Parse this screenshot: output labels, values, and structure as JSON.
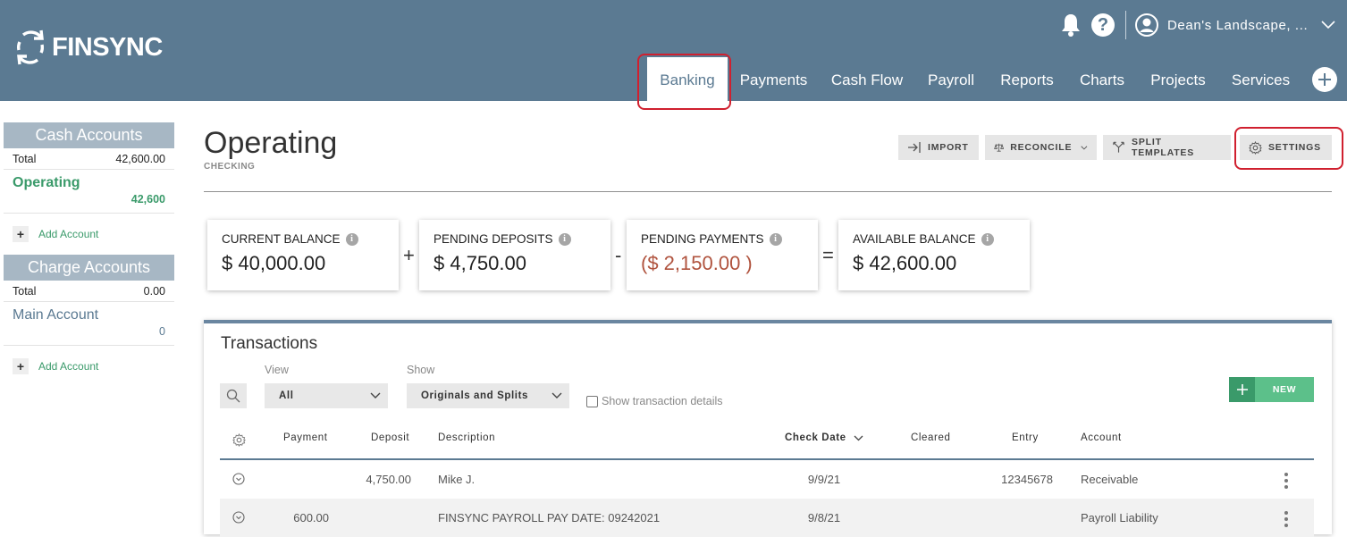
{
  "brand": {
    "name": "FINSYNC"
  },
  "header": {
    "company": "Dean's Landscape, ...",
    "help_glyph": "?",
    "nav": [
      {
        "label": "Banking",
        "active": true
      },
      {
        "label": "Payments",
        "active": false
      },
      {
        "label": "Cash Flow",
        "active": false
      },
      {
        "label": "Payroll",
        "active": false
      },
      {
        "label": "Reports",
        "active": false
      },
      {
        "label": "Charts",
        "active": false
      },
      {
        "label": "Projects",
        "active": false
      },
      {
        "label": "Services",
        "active": false
      }
    ],
    "icons": [
      "bell-icon",
      "help-icon",
      "user-icon",
      "chevron-down-icon",
      "plus-icon"
    ]
  },
  "sidebar": {
    "cash": {
      "title": "Cash Accounts",
      "total_label": "Total",
      "total_value": "42,600.00",
      "accounts": [
        {
          "name": "Operating",
          "value": "42,600",
          "active": true
        }
      ],
      "add_label": "Add Account"
    },
    "charge": {
      "title": "Charge Accounts",
      "total_label": "Total",
      "total_value": "0.00",
      "accounts": [
        {
          "name": "Main Account",
          "value": "0",
          "active": false
        }
      ],
      "add_label": "Add Account"
    }
  },
  "account": {
    "title": "Operating",
    "subtitle": "CHECKING"
  },
  "toolbar": {
    "import": "IMPORT",
    "reconcile": "RECONCILE",
    "split_templates": "SPLIT TEMPLATES",
    "settings": "SETTINGS"
  },
  "balances": {
    "current": {
      "label": "CURRENT BALANCE",
      "value": "$ 40,000.00"
    },
    "pending_deposits": {
      "label": "PENDING DEPOSITS",
      "value": "$ 4,750.00"
    },
    "pending_payments": {
      "label": "PENDING PAYMENTS",
      "value": "($ 2,150.00 )"
    },
    "available": {
      "label": "AVAILABLE BALANCE",
      "value": "$ 42,600.00"
    },
    "ops": [
      "+",
      "-",
      "="
    ],
    "info_glyph": "i",
    "negative_color": "#b0533e"
  },
  "transactions": {
    "title": "Transactions",
    "view_label": "View",
    "view_value": "All",
    "show_label": "Show",
    "show_value": "Originals and Splits",
    "details_checkbox": "Show transaction details",
    "new_button": "NEW",
    "columns": {
      "payment": "Payment",
      "deposit": "Deposit",
      "description": "Description",
      "check_date": "Check Date",
      "cleared": "Cleared",
      "entry": "Entry",
      "account": "Account"
    },
    "rows": [
      {
        "payment": "",
        "deposit": "4,750.00",
        "description": "Mike J.",
        "check_date": "9/9/21",
        "cleared": "",
        "entry": "12345678",
        "account": "Receivable"
      },
      {
        "payment": "600.00",
        "deposit": "",
        "description": "FINSYNC PAYROLL PAY DATE: 09242021",
        "check_date": "9/8/21",
        "cleared": "",
        "entry": "",
        "account": "Payroll Liability"
      }
    ]
  },
  "colors": {
    "header_bg": "#5b7a92",
    "accent_green": "#3a9a6a",
    "highlight_red": "#d0202f"
  }
}
